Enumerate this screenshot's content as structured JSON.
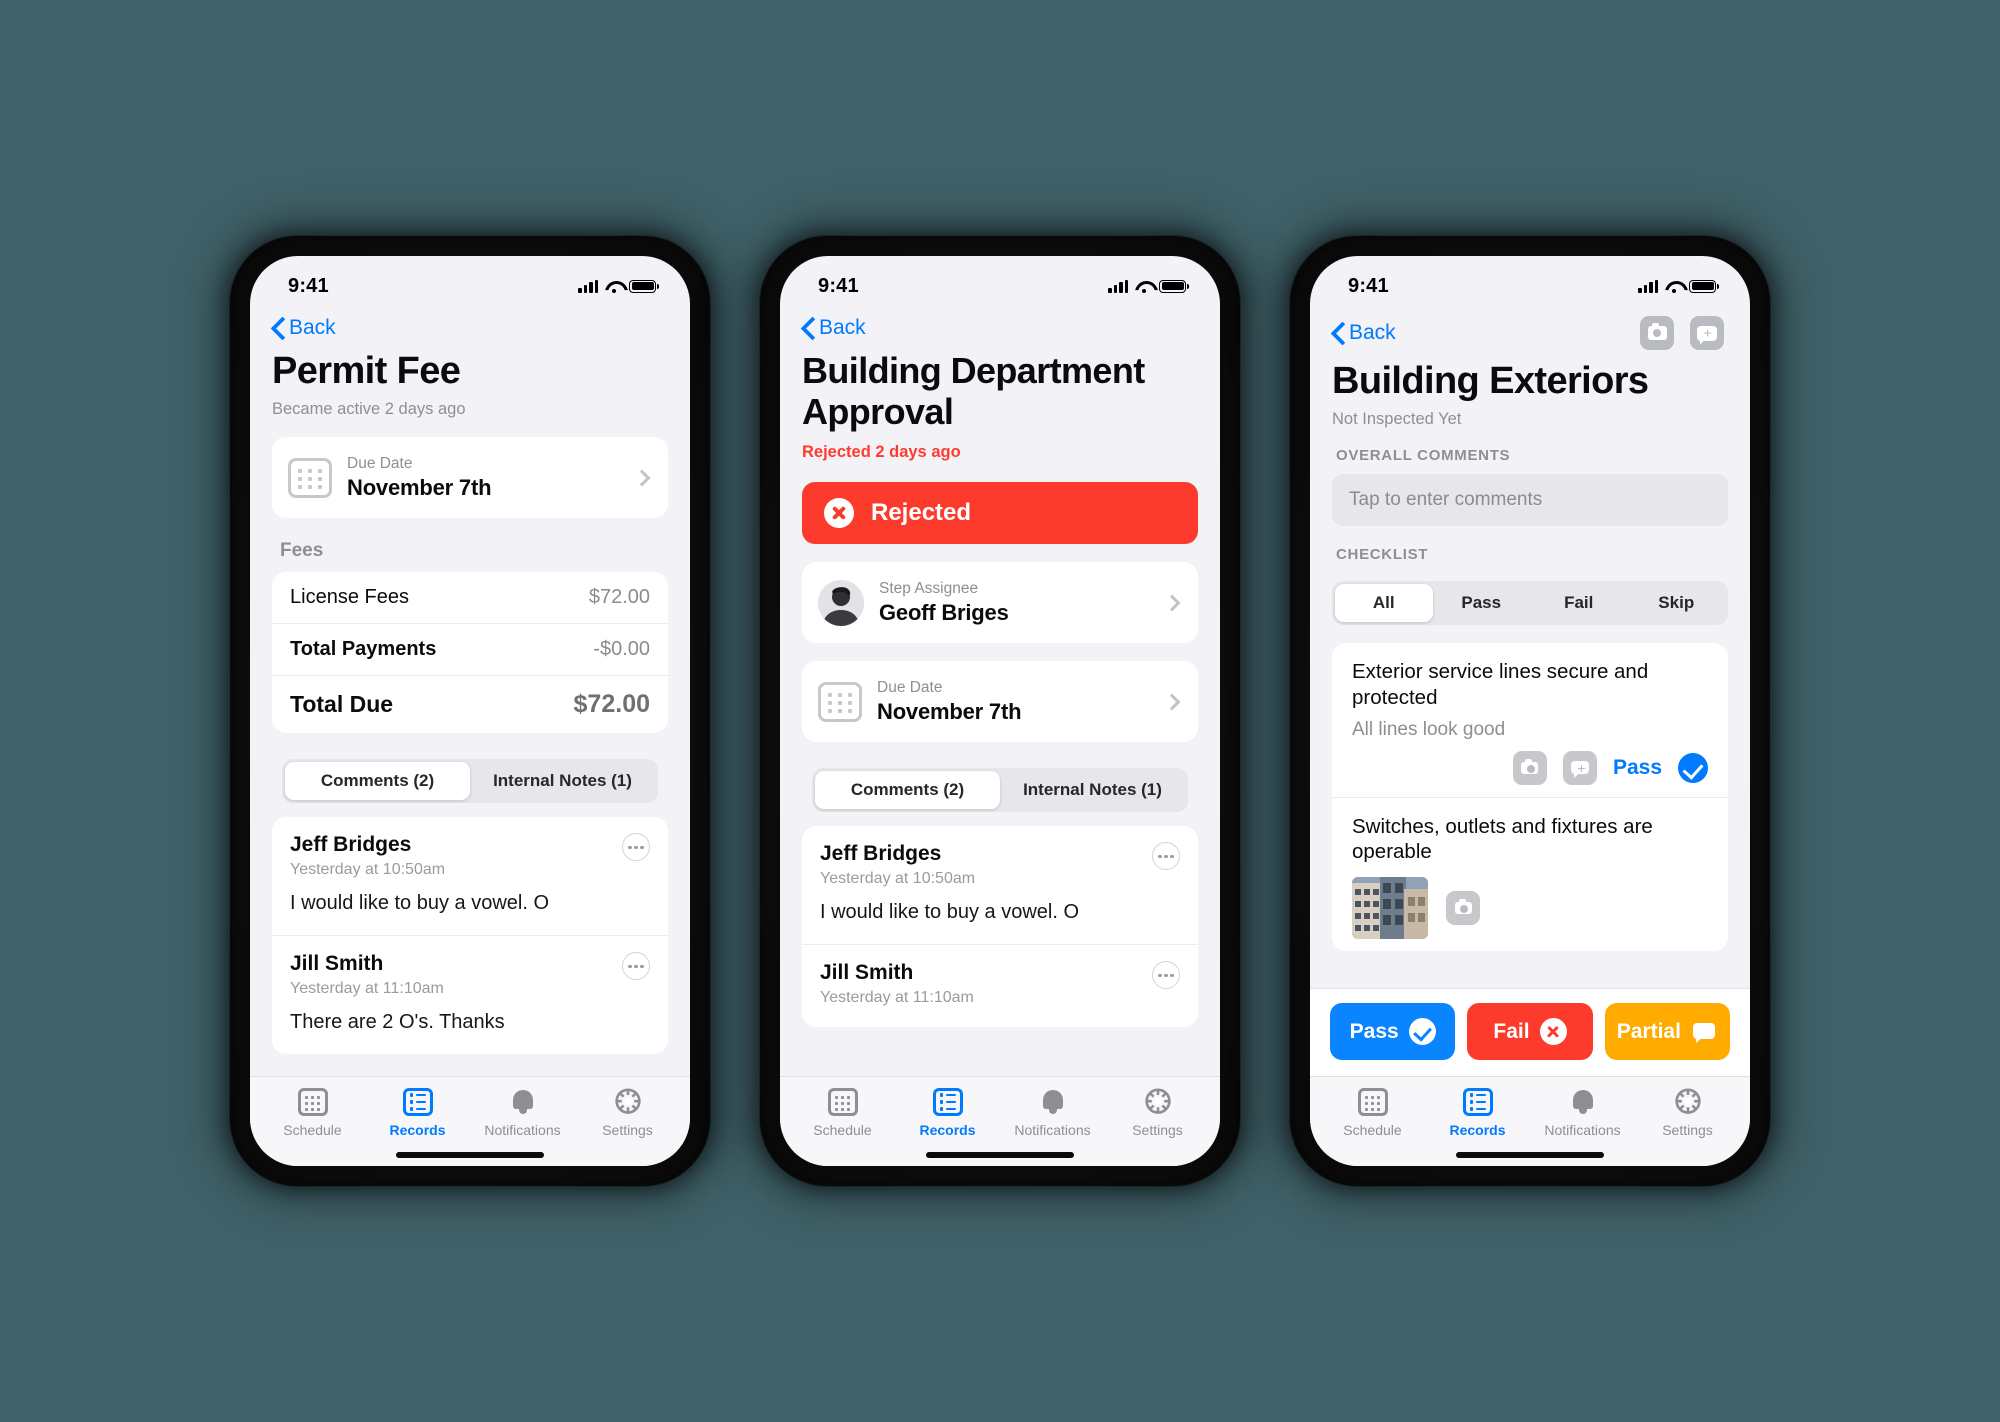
{
  "statusbar": {
    "time": "9:41"
  },
  "phone1": {
    "nav": {
      "back_label": "Back"
    },
    "title": "Permit Fee",
    "subtitle": "Became active 2 days ago",
    "due_date": {
      "caption": "Due Date",
      "value": "November 7th",
      "icon": "calendar-icon"
    },
    "fees_header": "Fees",
    "fees": [
      {
        "name": "License Fees",
        "amount": "$72.00",
        "bold": false,
        "total": false
      },
      {
        "name": "Total Payments",
        "amount": "-$0.00",
        "bold": true,
        "total": false
      },
      {
        "name": "Total Due",
        "amount": "$72.00",
        "bold": true,
        "total": true
      }
    ],
    "tabs": {
      "comments": "Comments (2)",
      "internal_notes": "Internal Notes (1)",
      "active": "comments"
    },
    "comments": [
      {
        "author": "Jeff Bridges",
        "time": "Yesterday at 10:50am",
        "text": "I would like to buy a vowel. O"
      },
      {
        "author": "Jill Smith",
        "time": "Yesterday at 11:10am",
        "text": "There are 2 O's. Thanks"
      }
    ],
    "tabbar": [
      {
        "label": "Schedule",
        "icon": "calendar-icon",
        "active": false
      },
      {
        "label": "Records",
        "icon": "records-icon",
        "active": true
      },
      {
        "label": "Notifications",
        "icon": "bell-icon",
        "active": false
      },
      {
        "label": "Settings",
        "icon": "gear-icon",
        "active": false
      }
    ]
  },
  "phone2": {
    "nav": {
      "back_label": "Back"
    },
    "title": "Building Department Approval",
    "subtitle": "Rejected 2 days ago",
    "status_banner": {
      "label": "Rejected",
      "icon": "x-circle-icon",
      "color": "#fc3b2d"
    },
    "assignee": {
      "caption": "Step Assignee",
      "value": "Geoff Briges",
      "icon": "avatar"
    },
    "due_date": {
      "caption": "Due Date",
      "value": "November 7th",
      "icon": "calendar-icon"
    },
    "tabs": {
      "comments": "Comments (2)",
      "internal_notes": "Internal Notes (1)",
      "active": "comments"
    },
    "comments": [
      {
        "author": "Jeff Bridges",
        "time": "Yesterday at 10:50am",
        "text": "I would like to buy a vowel. O"
      },
      {
        "author": "Jill Smith",
        "time": "Yesterday at 11:10am",
        "text": ""
      }
    ],
    "tabbar": [
      {
        "label": "Schedule",
        "icon": "calendar-icon",
        "active": false
      },
      {
        "label": "Records",
        "icon": "records-icon",
        "active": true
      },
      {
        "label": "Notifications",
        "icon": "bell-icon",
        "active": false
      },
      {
        "label": "Settings",
        "icon": "gear-icon",
        "active": false
      }
    ]
  },
  "phone3": {
    "nav": {
      "back_label": "Back",
      "camera_icon": "camera-icon",
      "add_comment_icon": "add-comment-icon"
    },
    "title": "Building Exteriors",
    "subtitle": "Not Inspected Yet",
    "overall_comments_header": "OVERALL COMMENTS",
    "overall_comments_placeholder": "Tap to enter comments",
    "checklist_header": "CHECKLIST",
    "filters": [
      {
        "label": "All",
        "active": true
      },
      {
        "label": "Pass",
        "active": false
      },
      {
        "label": "Fail",
        "active": false
      },
      {
        "label": "Skip",
        "active": false
      }
    ],
    "checklist": [
      {
        "title": "Exterior service lines secure and protected",
        "note": "All lines look good",
        "status_label": "Pass",
        "has_photo": false
      },
      {
        "title": "Switches, outlets and fixtures are operable",
        "note": "",
        "status_label": "",
        "has_photo": true
      }
    ],
    "actions": [
      {
        "label": "Pass",
        "color": "#0a84ff",
        "icon": "check-circle-icon"
      },
      {
        "label": "Fail",
        "color": "#fc3b2d",
        "icon": "x-circle-icon"
      },
      {
        "label": "Partial",
        "color": "#ffab00",
        "icon": "comment-icon"
      }
    ],
    "tabbar": [
      {
        "label": "Schedule",
        "icon": "calendar-icon",
        "active": false
      },
      {
        "label": "Records",
        "icon": "records-icon",
        "active": true
      },
      {
        "label": "Notifications",
        "icon": "bell-icon",
        "active": false
      },
      {
        "label": "Settings",
        "icon": "gear-icon",
        "active": false
      }
    ]
  }
}
